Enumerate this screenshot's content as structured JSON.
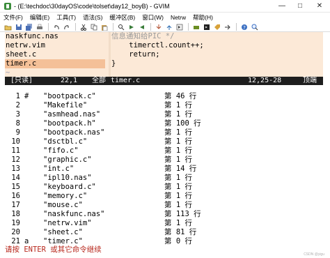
{
  "window": {
    "title": "- (E:\\techdoc\\30dayOS\\code\\tolset\\day12_boyB) - GVIM",
    "controls": [
      "—",
      "□",
      "✕"
    ]
  },
  "menubar": [
    "文件(F)",
    "编辑(E)",
    "工具(T)",
    "语法(S)",
    "缓冲区(B)",
    "窗口(W)",
    "Netrw",
    "帮助(H)"
  ],
  "toolbar": {
    "buttons": [
      "open-icon",
      "save-icon",
      "save-all-icon",
      "print-icon",
      "undo-icon",
      "redo-icon",
      "cut-icon",
      "copy-icon",
      "paste-icon",
      "replace-icon",
      "find-next-icon",
      "find-prev-icon",
      "load-session-icon",
      "save-session-icon",
      "run-script-icon",
      "make-icon",
      "shell-icon",
      "ctags-icon",
      "tag-jump-icon",
      "help-icon",
      "find-help-icon"
    ]
  },
  "left_pane": {
    "lines": [
      "naskfunc.nas",
      "netrw.vim",
      "sheet.c",
      "timer.c"
    ],
    "tilde": "~",
    "cursor_line": 3
  },
  "right_pane": {
    "lines": [
      "信息通知给PIC */",
      "    timerctl.count++;",
      "    return;",
      "}"
    ]
  },
  "statusline": {
    "readonly": "[只读]",
    "left_pos": "22,1",
    "left_pct": "全部",
    "filename": "timer.c",
    "right_pos": "12,25-28",
    "right_pct": "顶端"
  },
  "ls_output": [
    {
      "num": "1",
      "flag": "#",
      "name": "\"bootpack.c\"",
      "line": "第 46 行"
    },
    {
      "num": "2",
      "flag": "",
      "name": "\"Makefile\"",
      "line": "第 1 行"
    },
    {
      "num": "3",
      "flag": "",
      "name": "\"asmhead.nas\"",
      "line": "第 1 行"
    },
    {
      "num": "8",
      "flag": "",
      "name": "\"bootpack.h\"",
      "line": "第 100 行"
    },
    {
      "num": "9",
      "flag": "",
      "name": "\"bootpack.nas\"",
      "line": "第 1 行"
    },
    {
      "num": "10",
      "flag": "",
      "name": "\"dsctbl.c\"",
      "line": "第 1 行"
    },
    {
      "num": "11",
      "flag": "",
      "name": "\"fifo.c\"",
      "line": "第 1 行"
    },
    {
      "num": "12",
      "flag": "",
      "name": "\"graphic.c\"",
      "line": "第 1 行"
    },
    {
      "num": "13",
      "flag": "",
      "name": "\"int.c\"",
      "line": "第 14 行"
    },
    {
      "num": "14",
      "flag": "",
      "name": "\"ipl10.nas\"",
      "line": "第 1 行"
    },
    {
      "num": "15",
      "flag": "",
      "name": "\"keyboard.c\"",
      "line": "第 1 行"
    },
    {
      "num": "16",
      "flag": "",
      "name": "\"memory.c\"",
      "line": "第 1 行"
    },
    {
      "num": "17",
      "flag": "",
      "name": "\"mouse.c\"",
      "line": "第 1 行"
    },
    {
      "num": "18",
      "flag": "",
      "name": "\"naskfunc.nas\"",
      "line": "第 113 行"
    },
    {
      "num": "19",
      "flag": "",
      "name": "\"netrw.vim\"",
      "line": "第 1 行"
    },
    {
      "num": "20",
      "flag": "",
      "name": "\"sheet.c\"",
      "line": "第 81 行"
    },
    {
      "num": "21",
      "flag": "a",
      "name": "\"timer.c\"",
      "line": "第 0 行"
    }
  ],
  "prompt": "请按 ENTER 或其它命令继续",
  "watermark": "CSDN @yigu",
  "colors": {
    "pane_bg": "#fce9d7",
    "cursor_line": "#f4c098",
    "statusline_bg": "#1e1e1e",
    "prompt": "#b8281d"
  }
}
